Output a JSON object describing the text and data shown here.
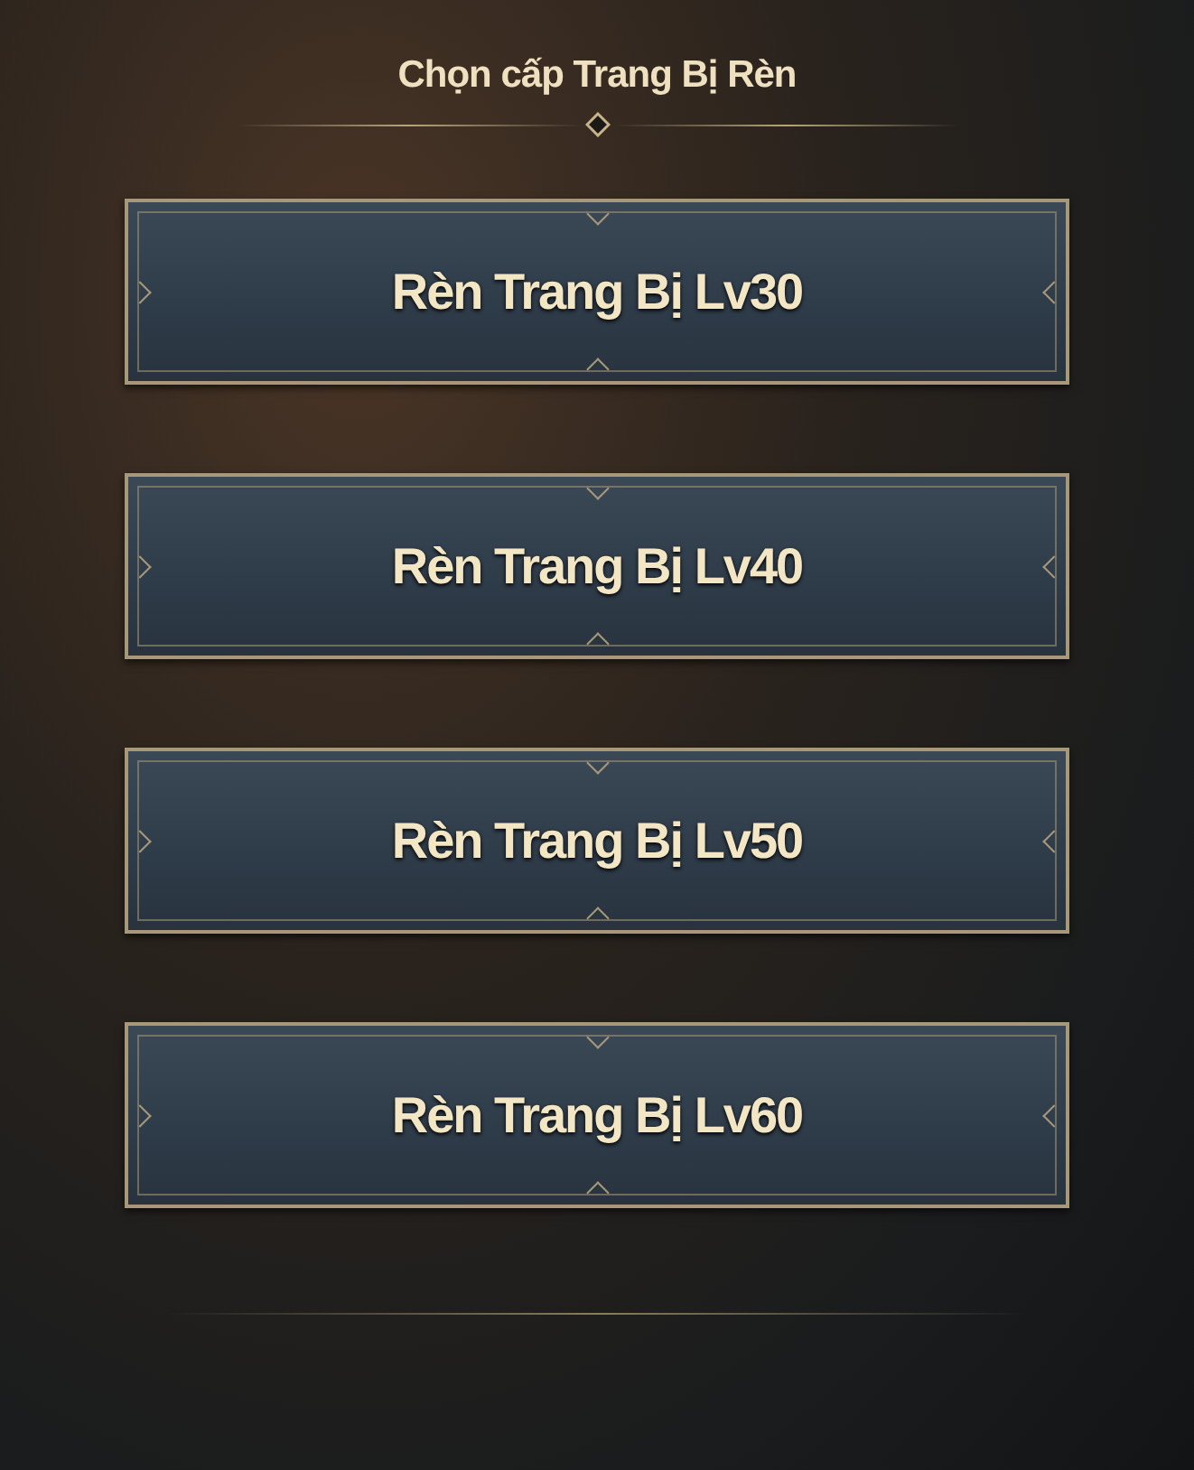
{
  "title": "Chọn cấp Trang Bị Rèn",
  "options": [
    {
      "label": "Rèn Trang Bị Lv30"
    },
    {
      "label": "Rèn Trang Bị Lv40"
    },
    {
      "label": "Rèn Trang Bị Lv50"
    },
    {
      "label": "Rèn Trang Bị Lv60"
    }
  ]
}
